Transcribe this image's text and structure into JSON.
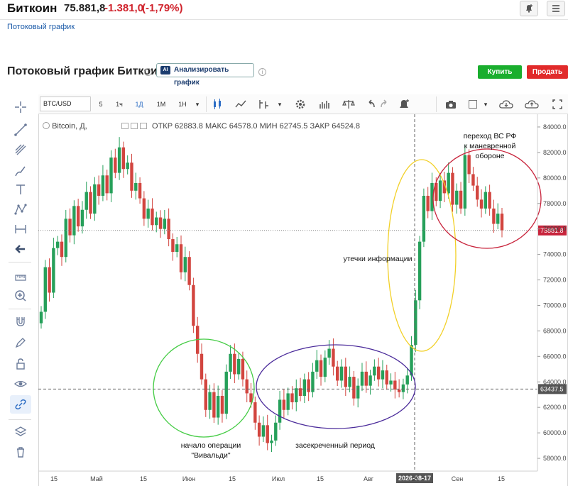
{
  "header": {
    "asset_name": "Биткоин",
    "price": "75.881,8",
    "change": "-1.381,0",
    "change_pct": "(-1,79%)",
    "sublink": "Потоковый график",
    "bell_icon": "bell-plus-icon",
    "menu_icon": "hamburger-icon"
  },
  "title_row": {
    "title": "Потоковый график Биткоин",
    "analyze_badge": "AI",
    "analyze_label": "Анализировать график",
    "buy_label": "Купить",
    "sell_label": "Продать"
  },
  "toolbar": {
    "symbol": "BTC/USD",
    "intervals": [
      "5",
      "1ч",
      "1Д",
      "1М",
      "1Н"
    ],
    "active_interval": "1Д"
  },
  "legend": {
    "instrument": "Bitcoin, Д,",
    "open_label": "ОТКР",
    "open": "62883.8",
    "high_label": "МАКС",
    "high": "64578.0",
    "low_label": "МИН",
    "low": "62745.5",
    "close_label": "ЗАКР",
    "close": "64524.8"
  },
  "colors": {
    "up": "#26a05a",
    "down": "#d2453f",
    "green_ellipse": "#45cc45",
    "purple_ellipse": "#4a2a9a",
    "yellow_ellipse": "#f2d027",
    "red_ellipse": "#c8243c"
  },
  "chart_data": {
    "type": "candlestick",
    "ylim": [
      57000,
      85000
    ],
    "y_ticks": [
      "58000.0",
      "60000.0",
      "62000.0",
      "64000.0",
      "66000.0",
      "68000.0",
      "70000.0",
      "72000.0",
      "74000.0",
      "76000.0",
      "78000.0",
      "80000.0",
      "82000.0",
      "84000.0"
    ],
    "x_tick_labels": [
      "15",
      "Май",
      "15",
      "Июн",
      "15",
      "Июл",
      "15",
      "Авг",
      "15",
      "2026-08-17",
      "Сен",
      "15"
    ],
    "current_price": "75881.8",
    "crosshair_price": "63437.5",
    "crosshair_date": "2026-08-17",
    "annotations": [
      {
        "text": "начало операции",
        "text2": "\"Вивальди\""
      },
      {
        "text": "засекреченный период"
      },
      {
        "text": "утечки информации"
      },
      {
        "text": "переход ВС РФ",
        "text2": "к маневренной",
        "text3": "обороне"
      }
    ],
    "closes": [
      69500,
      73000,
      71000,
      74500,
      75000,
      73800,
      76800,
      75500,
      77800,
      76200,
      77500,
      78900,
      77200,
      79500,
      78600,
      80200,
      78800,
      81600,
      80400,
      82400,
      80700,
      81200,
      79000,
      79600,
      78400,
      76800,
      77600,
      76300,
      76900,
      76000,
      76800,
      75200,
      74200,
      74800,
      72600,
      73800,
      71600,
      68400,
      66200,
      64200,
      61800,
      63200,
      61200,
      62900,
      61500,
      64800,
      66200,
      64600,
      65800,
      64200,
      63100,
      62400,
      60800,
      59700,
      60600,
      59200,
      59400,
      60800,
      62600,
      61800,
      63100,
      62400,
      63500,
      62900,
      64200,
      63200,
      64800,
      65700,
      64400,
      65900,
      66600,
      65200,
      64100,
      65200,
      63600,
      64400,
      62700,
      63700,
      64800,
      63700,
      64500,
      65200,
      64200,
      64900,
      63800,
      64100,
      63400,
      63200,
      63800,
      64500,
      66900,
      70400,
      75000,
      78600,
      77400,
      79600,
      78200,
      79800,
      78800,
      80400,
      77900,
      79000,
      77600,
      81800,
      80300,
      79400,
      78300,
      77600,
      78900,
      77600,
      76400,
      77200,
      75900
    ]
  }
}
